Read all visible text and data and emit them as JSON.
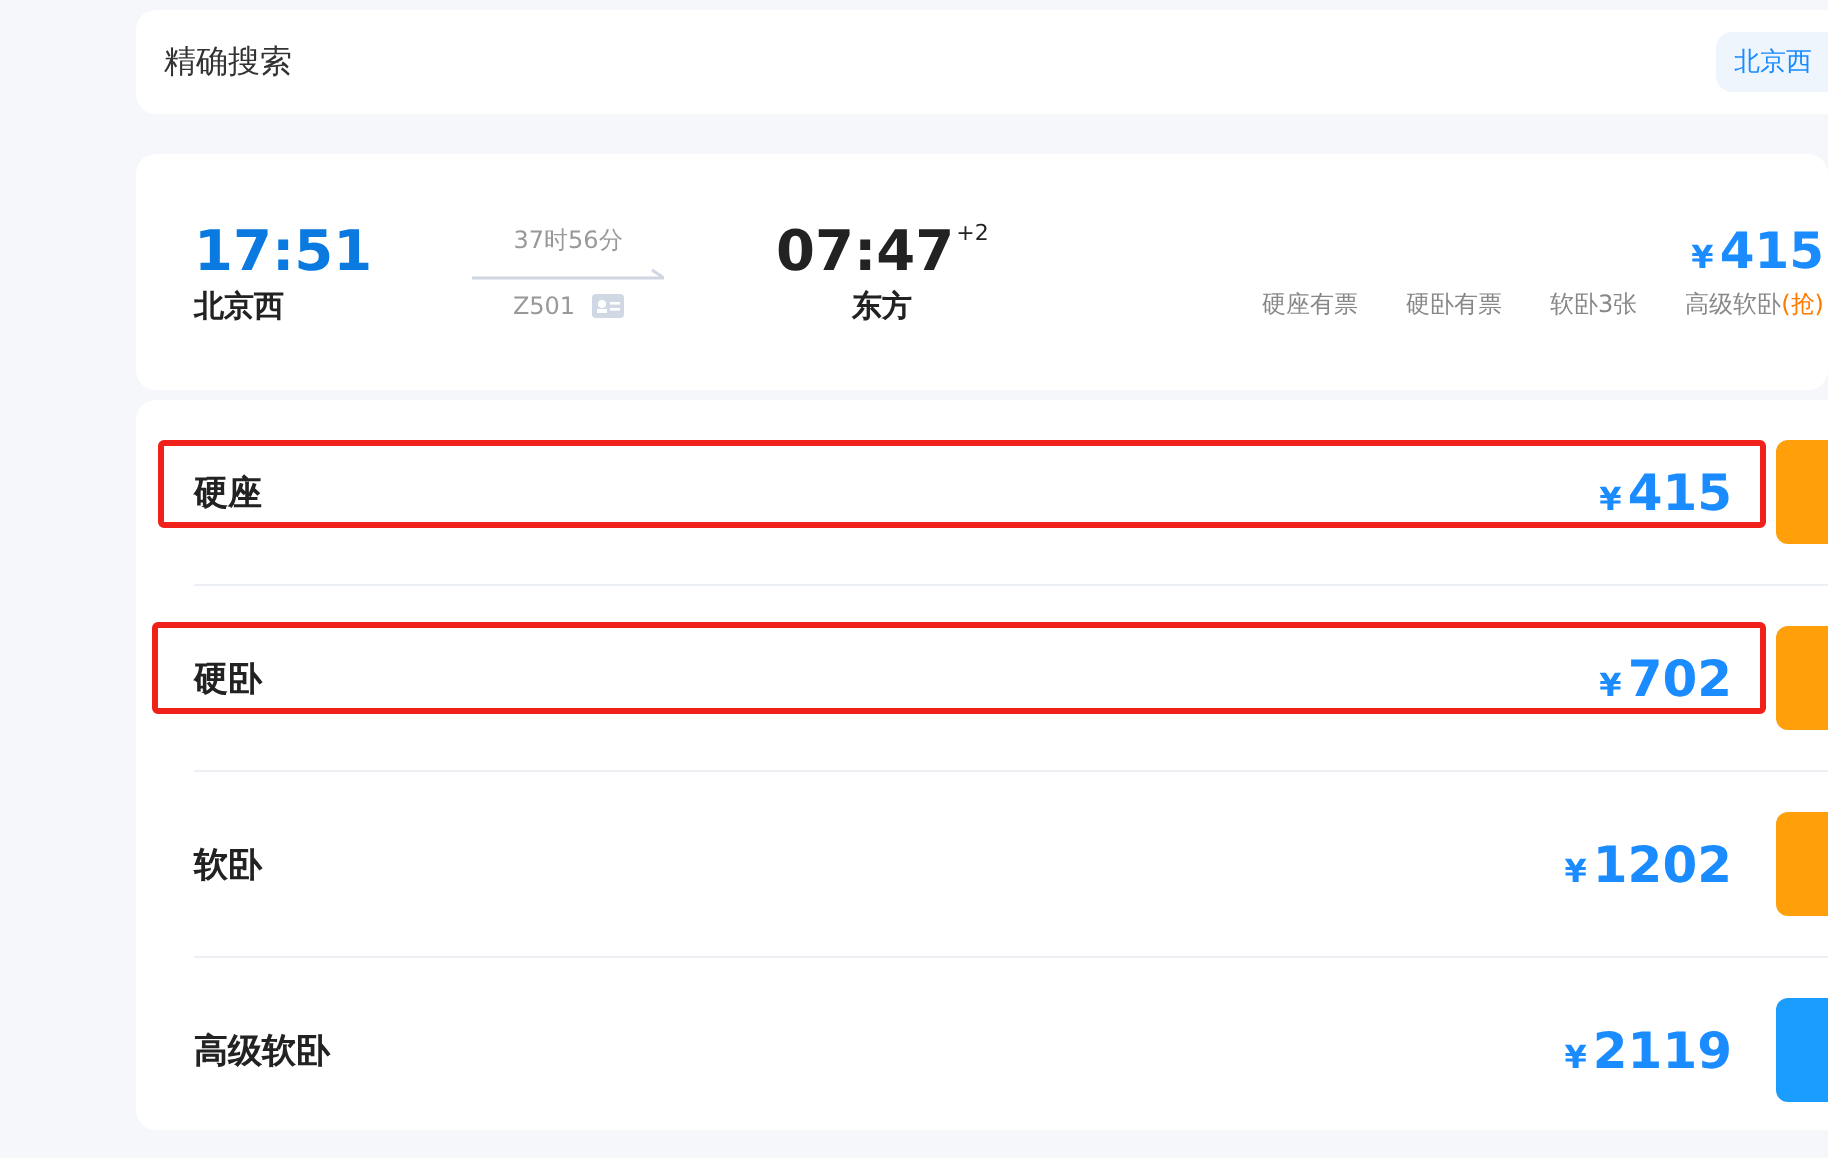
{
  "search_bar": {
    "label": "精确搜索",
    "chip": "北京西"
  },
  "train": {
    "depart_time": "17:51",
    "depart_station": "北京西",
    "duration": "37时56分",
    "number": "Z501",
    "arrive_time": "07:47",
    "day_offset": "+2",
    "arrive_station": "东方",
    "price_currency": "¥",
    "price": "415",
    "availability": [
      {
        "text": "硬座有票"
      },
      {
        "text": "硬卧有票"
      },
      {
        "text": "软卧3张"
      },
      {
        "text": "高级软卧",
        "tag": "(抢)"
      }
    ]
  },
  "seats": [
    {
      "name": "硬座",
      "currency": "¥",
      "price": "415",
      "color": "#ff9f0a",
      "highlighted": true
    },
    {
      "name": "硬卧",
      "currency": "¥",
      "price": "702",
      "color": "#ff9f0a",
      "highlighted": true
    },
    {
      "name": "软卧",
      "currency": "¥",
      "price": "1202",
      "color": "#ff9f0a",
      "highlighted": false
    },
    {
      "name": "高级软卧",
      "currency": "¥",
      "price": "2119",
      "color": "#1a9dff",
      "highlighted": false
    }
  ]
}
